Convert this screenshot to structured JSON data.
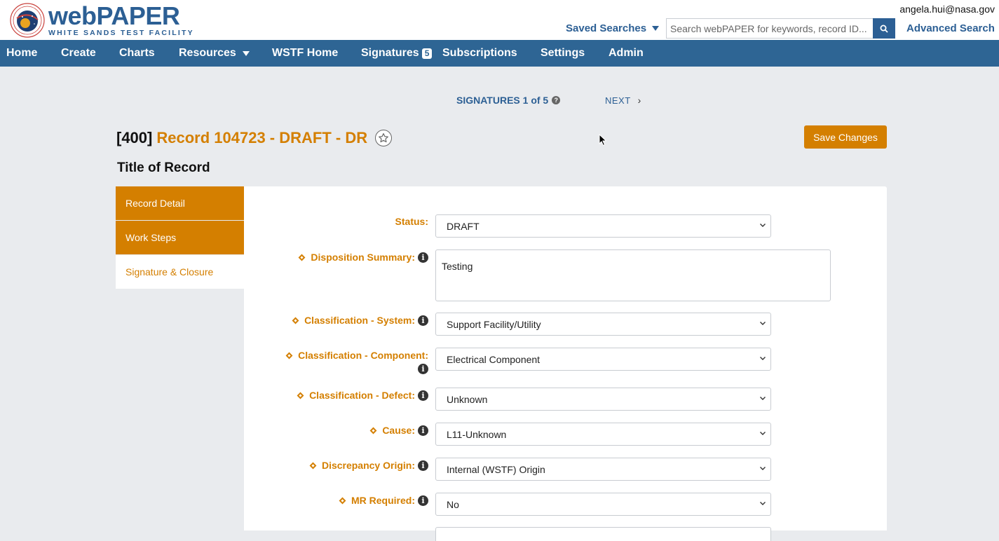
{
  "header": {
    "logo_main": "webPAPER",
    "logo_sub": "WHITE SANDS TEST FACILITY",
    "user_email": "angela.hui@nasa.gov",
    "saved_searches_label": "Saved Searches",
    "search_placeholder": "Search webPAPER for keywords, record ID...",
    "advanced_search_label": "Advanced Search"
  },
  "nav": {
    "home": "Home",
    "create": "Create",
    "charts": "Charts",
    "resources": "Resources",
    "wstf_home": "WSTF Home",
    "signatures": "Signatures",
    "signatures_count": "5",
    "subscriptions": "Subscriptions",
    "settings": "Settings",
    "admin": "Admin"
  },
  "pager": {
    "signatures_label": "SIGNATURES 1 of 5",
    "help": "?",
    "next_label": "NEXT",
    "next_chevron": "›"
  },
  "record": {
    "id": "[400]",
    "name": "Record 104723 - DRAFT - DR",
    "save_label": "Save Changes",
    "subtitle": "Title of Record"
  },
  "side_tabs": [
    {
      "label": "Record Detail"
    },
    {
      "label": "Work Steps"
    },
    {
      "label": "Signature & Closure"
    }
  ],
  "form": {
    "status": {
      "label": "Status:",
      "value": "DRAFT"
    },
    "disposition_summary": {
      "label": "Disposition Summary:",
      "value": "Testing"
    },
    "class_system": {
      "label": "Classification - System:",
      "value": "Support Facility/Utility"
    },
    "class_component": {
      "label": "Classification - Component:",
      "value": "Electrical Component"
    },
    "class_defect": {
      "label": "Classification - Defect:",
      "value": "Unknown"
    },
    "cause": {
      "label": "Cause:",
      "value": "L11-Unknown"
    },
    "discrepancy_origin": {
      "label": "Discrepancy Origin:",
      "value": "Internal (WSTF) Origin"
    },
    "mr_required": {
      "label": "MR Required:",
      "value": "No"
    },
    "info_glyph": "i"
  },
  "colors": {
    "brand_blue": "#2e6594",
    "accent_orange": "#d47f00"
  }
}
